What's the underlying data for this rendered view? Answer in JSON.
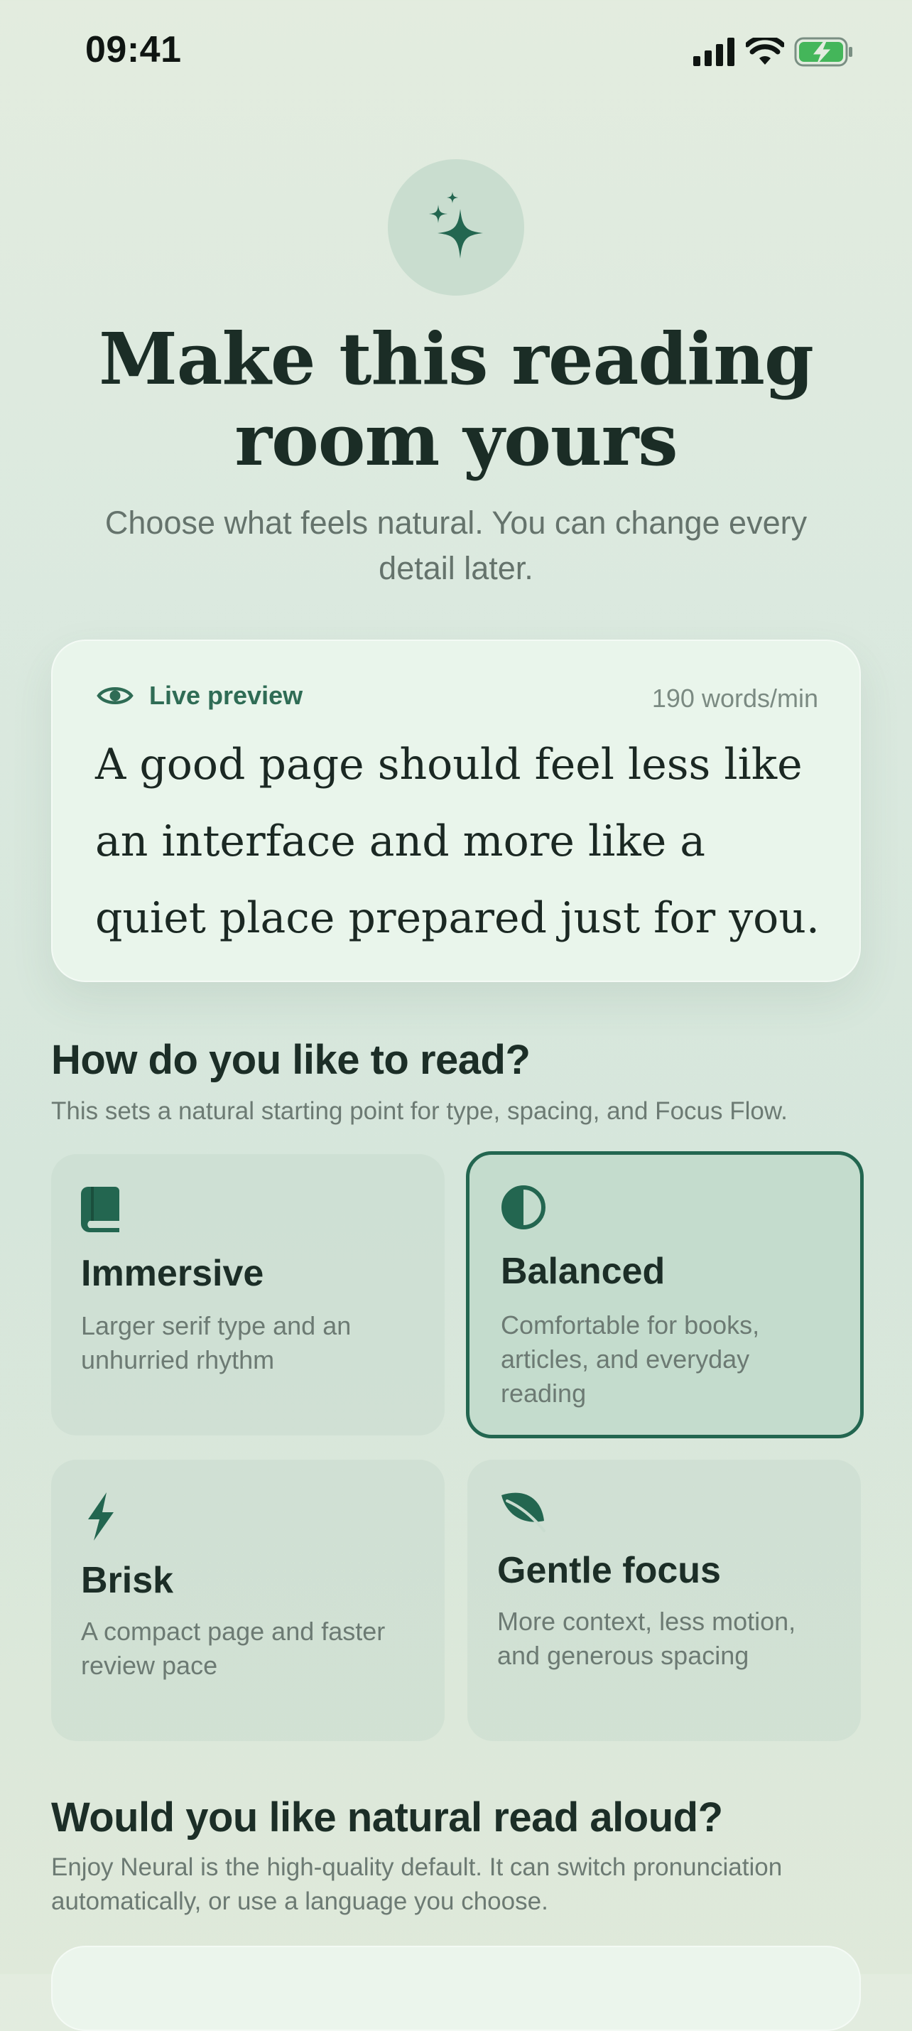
{
  "status_bar": {
    "time": "09:41"
  },
  "hero": {
    "icon": "sparkle-icon",
    "title": "Make this reading room yours",
    "subtitle": "Choose what feels natural. You can change every detail later."
  },
  "preview": {
    "icon": "eye-icon",
    "label": "Live preview",
    "speed": "190 words/min",
    "text": "A good page should feel less like an interface and more like a quiet place prepared just for you."
  },
  "reading_style": {
    "title": "How do you like to read?",
    "description": "This sets a natural starting point for type, spacing, and Focus Flow.",
    "options": [
      {
        "title": "Immersive",
        "description": "Larger serif type and an unhurried rhythm",
        "icon": "book-icon",
        "selected": false
      },
      {
        "title": "Balanced",
        "description": "Comfortable for books, articles, and everyday reading",
        "icon": "half-circle-icon",
        "selected": true
      },
      {
        "title": "Brisk",
        "description": "A compact page and faster review pace",
        "icon": "bolt-icon",
        "selected": false
      },
      {
        "title": "Gentle focus",
        "description": "More context, less motion, and generous spacing",
        "icon": "leaf-icon",
        "selected": false
      }
    ]
  },
  "read_aloud": {
    "title": "Would you like natural read aloud?",
    "description": "Enjoy Neural is the high-quality default. It can switch pronunciation automatically, or use a language you choose."
  },
  "colors": {
    "accent": "#236650",
    "heading": "#1c2e27",
    "muted_text": "#6c7a73",
    "selected_card": "#c4dccd"
  }
}
